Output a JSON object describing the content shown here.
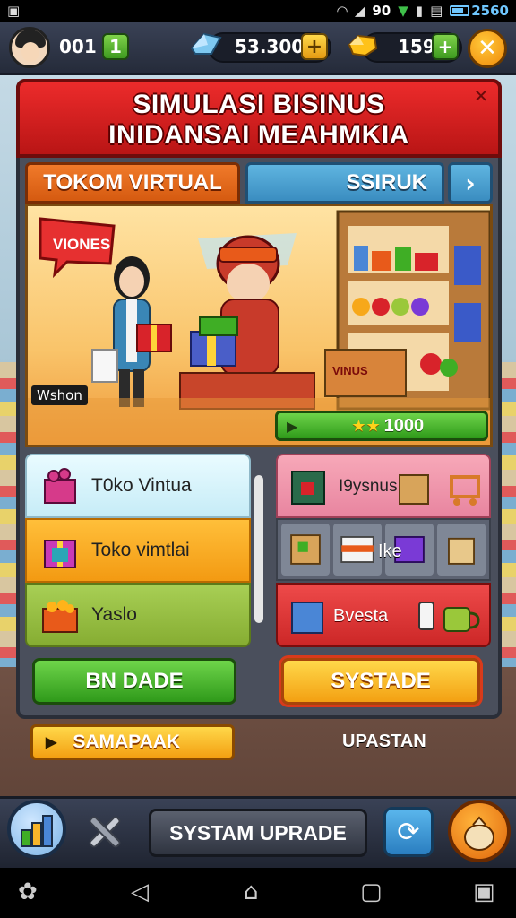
{
  "status_bar": {
    "signal_text": "90",
    "battery": "2560"
  },
  "top_bar": {
    "level": "001",
    "level_add": "1",
    "coins": "53.300",
    "coins_add": "+",
    "gold": "159",
    "gold_add": "+",
    "close": "✕"
  },
  "title": {
    "line1": "SIMULASI BISINUS",
    "line2": "INIDANSAI MEAHMKIA",
    "close": "✕"
  },
  "tabs": [
    {
      "label": "TOKOM VIRTUAL",
      "active": true
    },
    {
      "label": "SSIRUK",
      "active": false
    }
  ],
  "tab_next": "›",
  "scene": {
    "sign_text": "VIONES",
    "badge_text": "Wshon",
    "shelf_sign": "VINUS",
    "progress_value": "1000",
    "stars": "★★"
  },
  "list_items": [
    {
      "label": "T0ko Vintua"
    },
    {
      "label": "Toko vimtlai"
    },
    {
      "label": "Yaslo"
    }
  ],
  "shop_items": [
    {
      "label": "I9ysnus"
    },
    {
      "label": "Ike"
    },
    {
      "label": "Bvesta"
    }
  ],
  "buttons": {
    "left": "BN DADE",
    "right": "SYSTADE",
    "samapak": "SAMAPAAK",
    "upastan": "UPASTAN",
    "upgrade": "SYSTAM UPRADE"
  },
  "colors": {
    "title_red": "#d81c1c",
    "tab_orange": "#e86a1c",
    "tab_blue": "#4aa2d4",
    "green_btn": "#3fae25",
    "yellow_btn": "#f7b52a"
  }
}
